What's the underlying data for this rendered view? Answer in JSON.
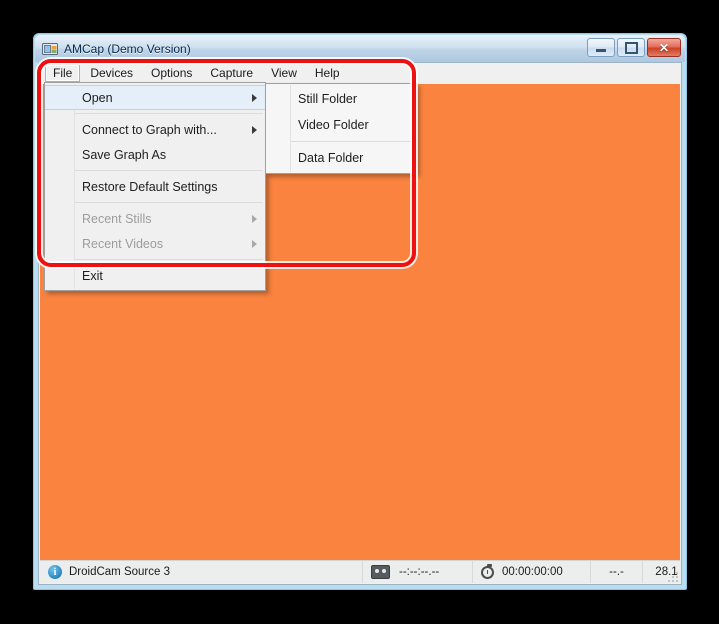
{
  "window": {
    "title": "AMCap (Demo Version)",
    "icon": "camera-icon",
    "minimize_label": "",
    "maximize_label": "",
    "close_label": "✕"
  },
  "menubar": {
    "items": [
      {
        "label": "File",
        "active": true
      },
      {
        "label": "Devices",
        "active": false
      },
      {
        "label": "Options",
        "active": false
      },
      {
        "label": "Capture",
        "active": false
      },
      {
        "label": "View",
        "active": false
      },
      {
        "label": "Help",
        "active": false
      }
    ]
  },
  "file_menu": {
    "items": [
      {
        "label": "Open",
        "submenu": true,
        "disabled": false,
        "selected": true,
        "separator_after": true
      },
      {
        "label": "Connect to Graph with...",
        "submenu": true,
        "disabled": false,
        "selected": false,
        "separator_after": false
      },
      {
        "label": "Save Graph As",
        "submenu": false,
        "disabled": false,
        "selected": false,
        "separator_after": true
      },
      {
        "label": "Restore Default Settings",
        "submenu": false,
        "disabled": false,
        "selected": false,
        "separator_after": true
      },
      {
        "label": "Recent Stills",
        "submenu": true,
        "disabled": true,
        "selected": false,
        "separator_after": false
      },
      {
        "label": "Recent Videos",
        "submenu": true,
        "disabled": true,
        "selected": false,
        "separator_after": true
      },
      {
        "label": "Exit",
        "submenu": false,
        "disabled": false,
        "selected": false,
        "separator_after": false
      }
    ]
  },
  "open_submenu": {
    "items": [
      {
        "label": "Still Folder",
        "separator_after": false
      },
      {
        "label": "Video Folder",
        "separator_after": true
      },
      {
        "label": "Data Folder",
        "separator_after": false
      }
    ]
  },
  "statusbar": {
    "source_icon": "info-icon",
    "source_label": "DroidCam Source 3",
    "frames_icon": "cassette-icon",
    "frames_value": "--:--:--.--",
    "time_icon": "stopwatch-icon",
    "time_value": "00:00:00:00",
    "rate_value": "--.-",
    "fps_value": "28.1",
    "audio_icon": "speaker-icon",
    "audio_value": "--",
    "resize_grip": "resize-grip-icon"
  },
  "video": {
    "color": "#f9833f"
  },
  "annotation": {
    "type": "highlight-rectangle",
    "color": "#ee1111"
  }
}
